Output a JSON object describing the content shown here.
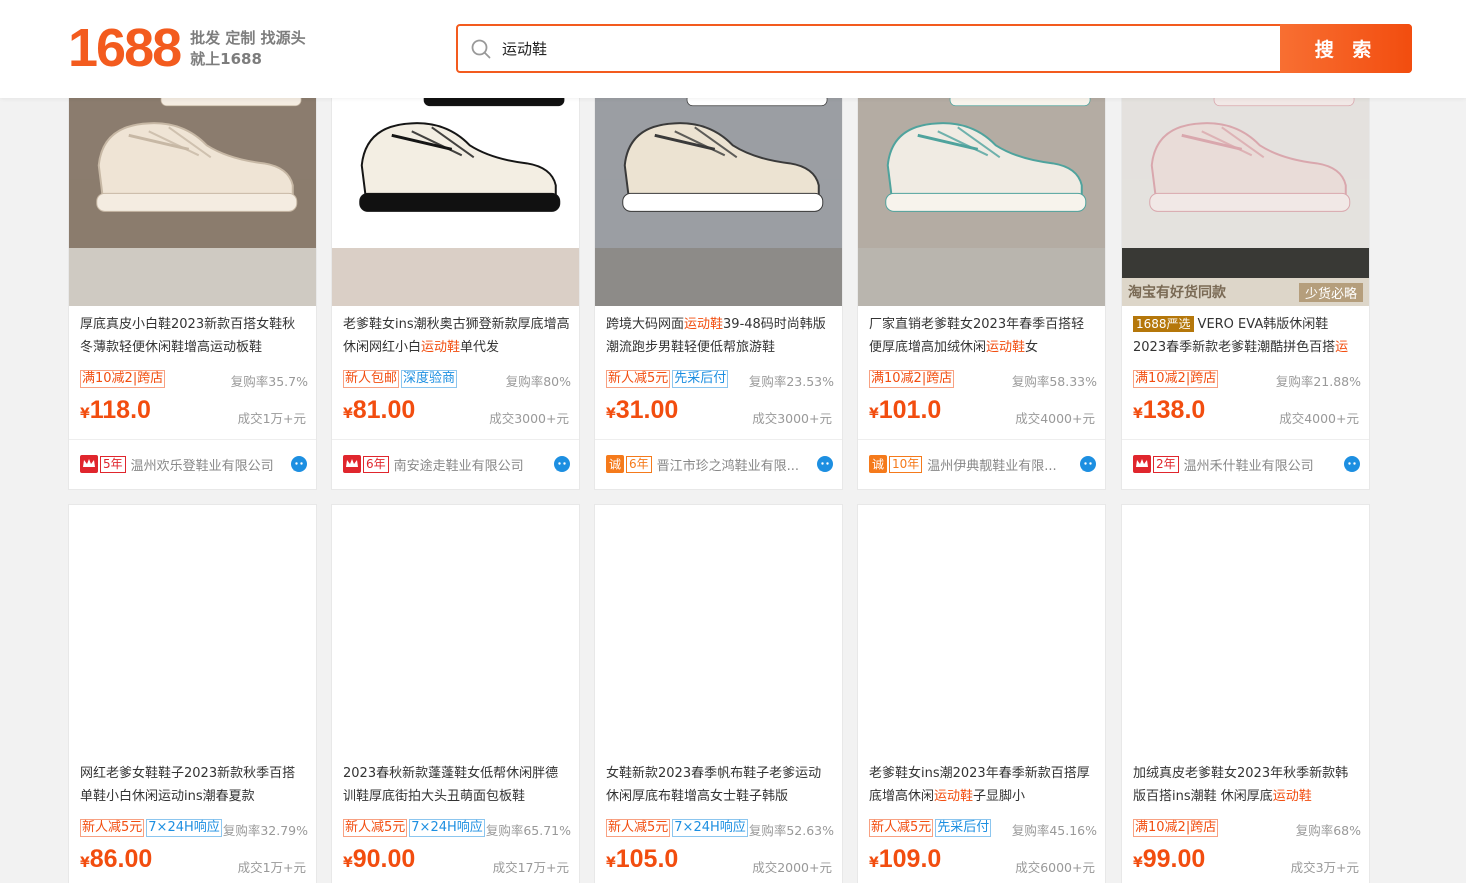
{
  "header": {
    "logo_text": "1688",
    "slogan_line1": "批发 定制 找源头",
    "slogan_line2": "就上1688",
    "search_value": "运动鞋",
    "search_button": "搜 索"
  },
  "products": [
    {
      "title_pre": "厚底真皮小白鞋2023新款百搭女鞋秋冬薄款轻便休闲鞋增高运动板鞋",
      "title_hl": "",
      "title_post": "",
      "badge": "",
      "tag1": "满10减2|跨店",
      "tag1_color": "orange",
      "tag2": "",
      "tag2_color": "",
      "repurchase": "复购率35.7%",
      "price": "118.0",
      "sold": "成交1万+元",
      "seal": "crown",
      "years": "5年",
      "company": "温州欢乐登鞋业有限公司",
      "img": {
        "bg": "#cfc9c2",
        "shoe": "#f5f3ef",
        "accent": "#b7b3ae",
        "sole": "#ffffff"
      }
    },
    {
      "title_pre": "老爹鞋女ins潮秋奥古狮登新款厚底增高休闲网红小白",
      "title_hl": "运动鞋",
      "title_post": "单代发",
      "badge": "",
      "tag1": "新人包邮",
      "tag1_color": "orange",
      "tag2": "深度验商",
      "tag2_color": "blue",
      "repurchase": "复购率80%",
      "price": "81.00",
      "sold": "成交3000+元",
      "seal": "crown",
      "years": "6年",
      "company": "南安途走鞋业有限公司",
      "img": {
        "bg": "#d9cfc6",
        "shoe": "#f1ede6",
        "accent": "#c9bfb2",
        "sole": "#e8e1d6"
      }
    },
    {
      "title_pre": "跨境大码网面",
      "title_hl": "运动鞋",
      "title_post": "39-48码时尚韩版潮流跑步男鞋轻便低帮旅游鞋",
      "badge": "",
      "tag1": "新人减5元",
      "tag1_color": "orange",
      "tag2": "先采后付",
      "tag2_color": "blue",
      "repurchase": "复购率23.53%",
      "price": "31.00",
      "sold": "成交3000+元",
      "seal": "cheng",
      "years": "6年",
      "company": "晋江市珍之鸿鞋业有限...",
      "img": {
        "bg": "#8d8b88",
        "shoe": "#5b5a5a",
        "accent": "#444444",
        "sole": "#f2f2f2"
      }
    },
    {
      "title_pre": "厂家直销老爹鞋女2023年春季百搭轻便厚底增高加绒休闲",
      "title_hl": "运动鞋",
      "title_post": "女",
      "badge": "",
      "tag1": "满10减2|跨店",
      "tag1_color": "orange",
      "tag2": "",
      "tag2_color": "",
      "repurchase": "复购率58.33%",
      "price": "101.0",
      "sold": "成交4000+元",
      "seal": "cheng",
      "years": "10年",
      "company": "温州伊典靓鞋业有限...",
      "img": {
        "bg": "#b9b5ae",
        "shoe": "#e9e4dc",
        "accent": "#2b2b2b",
        "sole": "#f5f1ea"
      }
    },
    {
      "title_pre": "VERO EVA韩版休闲鞋2023春季新款老爹鞋潮酷拼色百搭",
      "title_hl": "运",
      "title_post": "",
      "badge": "1688严选",
      "tag1": "满10减2|跨店",
      "tag1_color": "orange",
      "tag2": "",
      "tag2_color": "",
      "repurchase": "复购率21.88%",
      "price": "138.0",
      "sold": "成交4000+元",
      "seal": "crown",
      "years": "2年",
      "company": "温州禾什鞋业有限公司",
      "img": {
        "bg": "#3a3936",
        "shoe": "#d9d2c4",
        "accent": "#a6a7ab",
        "sole": "#ebe6dc"
      },
      "banner_left": "淘宝有好货同款",
      "banner_right": "少货必略"
    },
    {
      "title_pre": "网红老爹女鞋鞋子2023新款秋季百搭单鞋小白休闲运动ins潮春夏款",
      "title_hl": "",
      "title_post": "",
      "badge": "",
      "tag1": "新人减5元",
      "tag1_color": "orange",
      "tag2": "7×24H响应",
      "tag2_color": "blue",
      "repurchase": "复购率32.79%",
      "price": "86.00",
      "sold": "成交1万+元",
      "img": {
        "bg": "#8b7c6e",
        "shoe": "#efe4d5",
        "accent": "#c7b8a5",
        "sole": "#f4ece1"
      }
    },
    {
      "title_pre": "2023春秋新款蓬蓬鞋女低帮休闲胖德训鞋厚底街拍大头丑萌面包板鞋",
      "title_hl": "",
      "title_post": "",
      "badge": "",
      "tag1": "新人减5元",
      "tag1_color": "orange",
      "tag2": "7×24H响应",
      "tag2_color": "blue",
      "repurchase": "复购率65.71%",
      "price": "90.00",
      "sold": "成交17万+元",
      "img": {
        "bg": "#ffffff",
        "shoe": "#f3eee3",
        "accent": "#151515",
        "sole": "#111111"
      }
    },
    {
      "title_pre": "女鞋新款2023春季帆布鞋子老爹运动休闲厚底布鞋增高女士鞋子韩版",
      "title_hl": "",
      "title_post": "",
      "badge": "",
      "tag1": "新人减5元",
      "tag1_color": "orange",
      "tag2": "7×24H响应",
      "tag2_color": "blue",
      "repurchase": "复购率52.63%",
      "price": "105.0",
      "sold": "成交2000+元",
      "img": {
        "bg": "#9b9ea3",
        "shoe": "#ece3d2",
        "accent": "#3a3a3a",
        "sole": "#ffffff"
      }
    },
    {
      "title_pre": "老爹鞋女ins潮2023年春季新款百搭厚底增高休闲",
      "title_hl": "运动鞋",
      "title_post": "子显脚小",
      "badge": "",
      "tag1": "新人减5元",
      "tag1_color": "orange",
      "tag2": "先采后付",
      "tag2_color": "blue",
      "repurchase": "复购率45.16%",
      "price": "109.0",
      "sold": "成交6000+元",
      "img": {
        "bg": "#b4aca3",
        "shoe": "#f0ebe3",
        "accent": "#4fa39d",
        "sole": "#f7f3ec"
      }
    },
    {
      "title_pre": "加绒真皮老爹鞋女2023年秋季新款韩版百搭ins潮鞋 休闲厚底",
      "title_hl": "运动鞋",
      "title_post": "",
      "badge": "",
      "tag1": "满10减2|跨店",
      "tag1_color": "orange",
      "tag2": "",
      "tag2_color": "",
      "repurchase": "复购率68%",
      "price": "99.00",
      "sold": "成交3万+元",
      "img": {
        "bg": "#e4e1de",
        "shoe": "#e9dcd8",
        "accent": "#d9a7ad",
        "sole": "#f1e8e6"
      }
    }
  ],
  "currency_symbol": "¥"
}
